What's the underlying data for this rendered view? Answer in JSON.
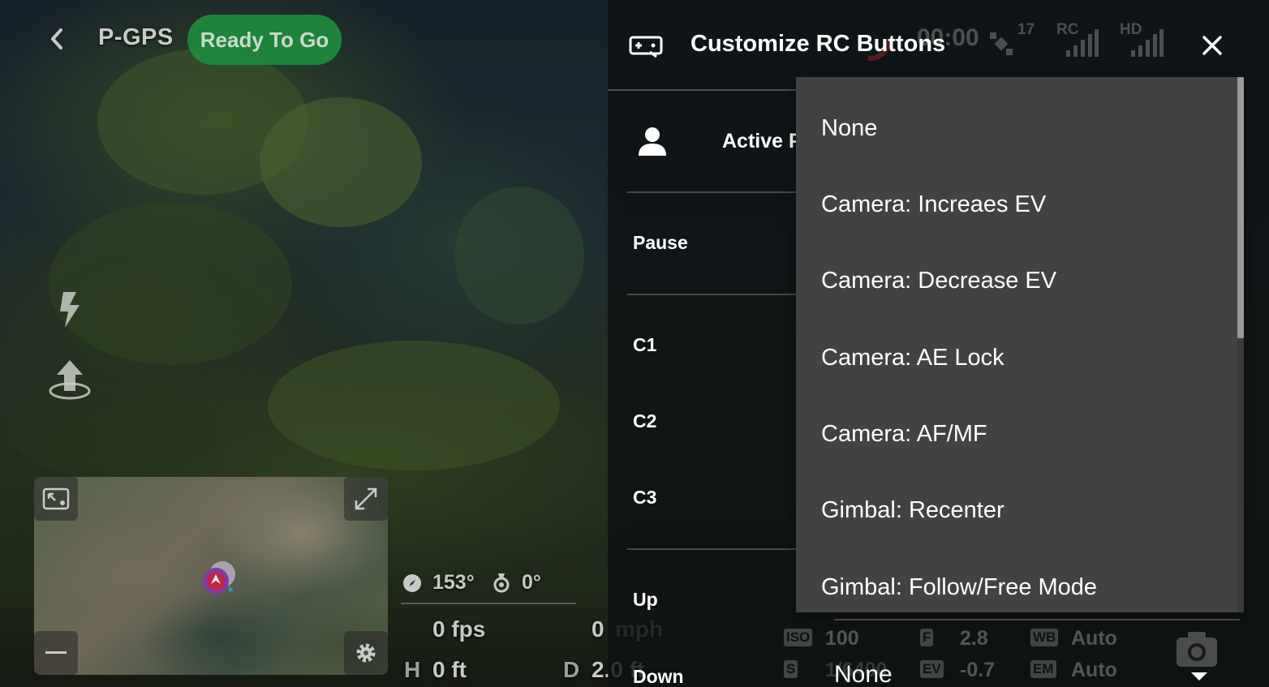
{
  "status_bar": {
    "flight_mode": "P-GPS",
    "status": "Ready To Go",
    "timer": "00:00",
    "satellites": "17",
    "rc_label": "RC",
    "hd_label": "HD"
  },
  "telemetry": {
    "heading": "153°",
    "gimbal_pitch": "0°",
    "fps": "0 fps",
    "speed_value": "0",
    "speed_unit": "mph",
    "height_letter": "H",
    "height": "0 ft",
    "distance_letter": "D",
    "distance": "2.0 ft"
  },
  "camera_settings": {
    "iso_label": "ISO",
    "iso": "100",
    "f_label": "F",
    "aperture": "2.8",
    "wb_label": "WB",
    "white_balance": "Auto",
    "s_label": "S",
    "shutter": "1/6400",
    "ev_label": "EV",
    "ev": "-0.7",
    "em_label": "EM",
    "exposure_mode": "Auto"
  },
  "panel": {
    "title": "Customize RC Buttons",
    "active_profile_label": "Active P",
    "rows": [
      {
        "label": "Pause"
      },
      {
        "label": "C1"
      },
      {
        "label": "C2"
      },
      {
        "label": "C3"
      },
      {
        "label": "Up"
      },
      {
        "label": "Down"
      }
    ],
    "down_value": "None"
  },
  "dropdown": {
    "options": [
      "None",
      "Camera: Increaes EV",
      "Camera: Decrease EV",
      "Camera: AE Lock",
      "Camera: AF/MF",
      "Gimbal: Recenter",
      "Gimbal: Follow/Free Mode"
    ]
  },
  "colors": {
    "status_green": "#1f8a3d",
    "dropdown_bg": "#424242",
    "panel_bg": "#0e1112"
  }
}
